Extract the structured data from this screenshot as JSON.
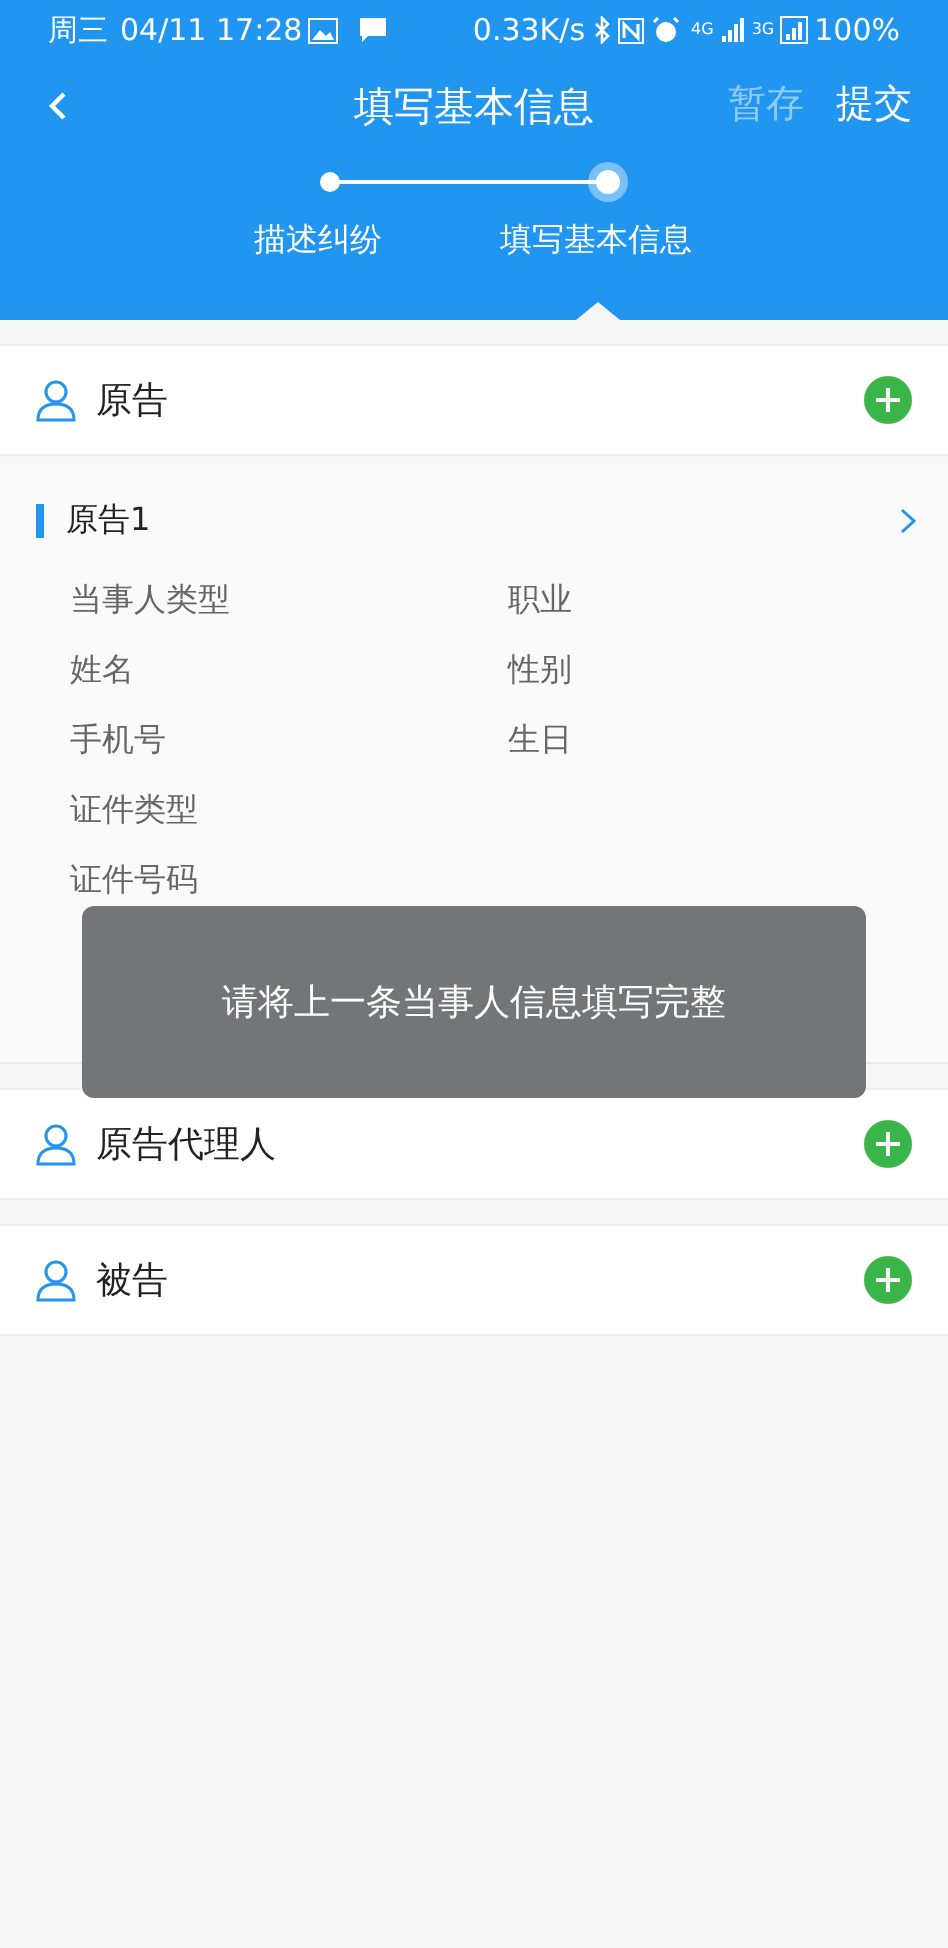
{
  "status_bar": {
    "day": "周三",
    "datetime": "04/11 17:28",
    "speed": "0.33K/s",
    "net_4g": "4G",
    "net_3g": "3G",
    "battery": "100%"
  },
  "header": {
    "title": "填写基本信息",
    "actions": [
      {
        "label": "暂存",
        "disabled": true
      },
      {
        "label": "提交",
        "disabled": false
      }
    ]
  },
  "steps": [
    {
      "label": "描述纠纷",
      "selected": false
    },
    {
      "label": "填写基本信息",
      "selected": true
    }
  ],
  "sections": [
    {
      "kind": "group",
      "title": "原告"
    },
    {
      "kind": "detail",
      "title": "原告1",
      "fields": [
        [
          "当事人类型",
          "职业"
        ],
        [
          "姓名",
          "性别"
        ],
        [
          "手机号",
          "生日"
        ],
        [
          "证件类型"
        ],
        [
          "证件号码"
        ]
      ]
    },
    {
      "kind": "group",
      "title": "原告代理人"
    },
    {
      "kind": "group",
      "title": "被告"
    }
  ],
  "toast": "请将上一条当事人信息填写完整"
}
